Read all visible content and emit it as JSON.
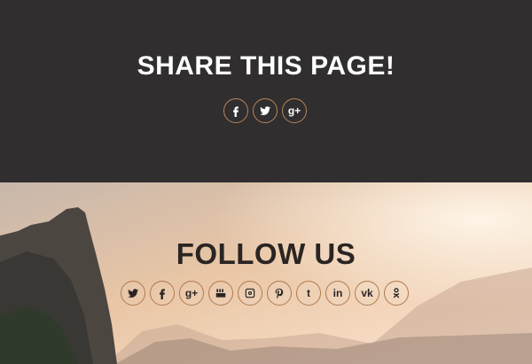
{
  "share": {
    "title": "SHARE THIS PAGE!",
    "icons": [
      "facebook-icon",
      "twitter-icon",
      "google-plus-icon"
    ]
  },
  "follow": {
    "title": "FOLLOW US",
    "icons": [
      "twitter-icon",
      "facebook-icon",
      "google-plus-icon",
      "youtube-icon",
      "instagram-icon",
      "pinterest-icon",
      "tumblr-icon",
      "linkedin-icon",
      "vk-icon",
      "odnoklassniki-icon"
    ]
  },
  "colors": {
    "dark_bg": "#302e2f",
    "accent_ring": "#b8865a",
    "heading_light": "#ffffff",
    "heading_dark": "#2a2522"
  }
}
